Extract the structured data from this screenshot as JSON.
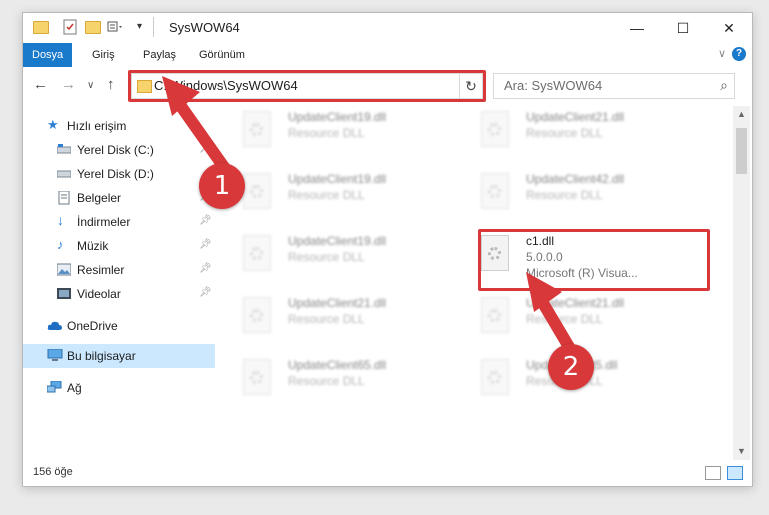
{
  "window": {
    "title": "SysWOW64",
    "controls": {
      "minimize": "—",
      "maximize": "☐",
      "close": "✕"
    }
  },
  "ribbon": {
    "tabs": [
      {
        "label": "Dosya",
        "active": true
      },
      {
        "label": "Giriş"
      },
      {
        "label": "Paylaş"
      },
      {
        "label": "Görünüm"
      }
    ],
    "help": "?"
  },
  "navigation": {
    "address": "C:\\Windows\\SysWOW64",
    "search_placeholder": "Ara: SysWOW64"
  },
  "sidebar": {
    "items": [
      {
        "label": "Hızlı erişim",
        "icon": "star-icon"
      },
      {
        "label": "Yerel Disk (C:)",
        "icon": "drive-icon",
        "pinned": true
      },
      {
        "label": "Yerel Disk (D:)",
        "icon": "drive-icon"
      },
      {
        "label": "Belgeler",
        "icon": "document-icon",
        "pinned": true
      },
      {
        "label": "İndirmeler",
        "icon": "download-icon",
        "pinned": true
      },
      {
        "label": "Müzik",
        "icon": "music-icon",
        "pinned": true
      },
      {
        "label": "Resimler",
        "icon": "pictures-icon",
        "pinned": true
      },
      {
        "label": "Videolar",
        "icon": "videos-icon",
        "pinned": true
      },
      {
        "label": "OneDrive",
        "icon": "cloud-icon"
      },
      {
        "label": "Bu bilgisayar",
        "icon": "computer-icon",
        "selected": true
      },
      {
        "label": "Ağ",
        "icon": "network-icon"
      }
    ]
  },
  "files": [
    {
      "name": "UpdateClient19.dll",
      "type": "Resource DLL",
      "blurred": true
    },
    {
      "name": "UpdateClient21.dll",
      "type": "Resource DLL",
      "blurred": true
    },
    {
      "name": "UpdateClient19.dll",
      "type": "Resource DLL",
      "blurred": true
    },
    {
      "name": "UpdateClient42.dll",
      "type": "Resource DLL",
      "blurred": true
    },
    {
      "name": "UpdateClient19.dll",
      "type": "Resource DLL",
      "blurred": true
    },
    {
      "name": "c1.dll",
      "version": "5.0.0.0",
      "type": "Microsoft (R) Visua...",
      "blurred": false,
      "highlighted": true
    },
    {
      "name": "UpdateClient21.dll",
      "type": "Resource DLL",
      "blurred": true
    },
    {
      "name": "UpdateClient21.dll",
      "type": "Resource DLL",
      "blurred": true
    },
    {
      "name": "UpdateClient65.dll",
      "type": "Resource DLL",
      "blurred": true
    },
    {
      "name": "UpdateClient5.dll",
      "type": "Resource DLL",
      "blurred": true
    }
  ],
  "status": {
    "item_count": "156 öğe"
  },
  "annotations": {
    "step1": "1",
    "step2": "2"
  },
  "colors": {
    "accent": "#1979ca",
    "highlight": "#d8383a",
    "selection": "#cce8ff"
  }
}
